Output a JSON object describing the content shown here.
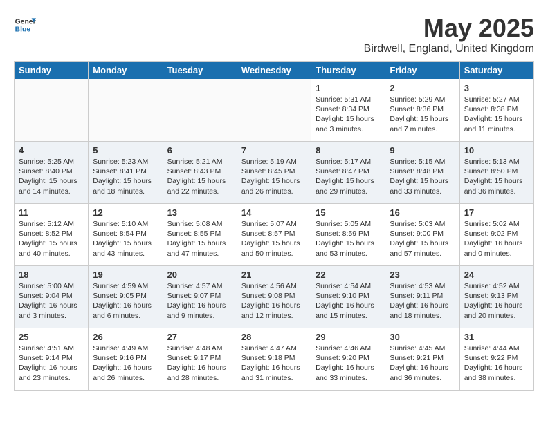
{
  "header": {
    "logo_general": "General",
    "logo_blue": "Blue",
    "month_title": "May 2025",
    "location": "Birdwell, England, United Kingdom"
  },
  "days_of_week": [
    "Sunday",
    "Monday",
    "Tuesday",
    "Wednesday",
    "Thursday",
    "Friday",
    "Saturday"
  ],
  "weeks": [
    [
      {
        "day": "",
        "content": ""
      },
      {
        "day": "",
        "content": ""
      },
      {
        "day": "",
        "content": ""
      },
      {
        "day": "",
        "content": ""
      },
      {
        "day": "1",
        "content": "Sunrise: 5:31 AM\nSunset: 8:34 PM\nDaylight: 15 hours\nand 3 minutes."
      },
      {
        "day": "2",
        "content": "Sunrise: 5:29 AM\nSunset: 8:36 PM\nDaylight: 15 hours\nand 7 minutes."
      },
      {
        "day": "3",
        "content": "Sunrise: 5:27 AM\nSunset: 8:38 PM\nDaylight: 15 hours\nand 11 minutes."
      }
    ],
    [
      {
        "day": "4",
        "content": "Sunrise: 5:25 AM\nSunset: 8:40 PM\nDaylight: 15 hours\nand 14 minutes."
      },
      {
        "day": "5",
        "content": "Sunrise: 5:23 AM\nSunset: 8:41 PM\nDaylight: 15 hours\nand 18 minutes."
      },
      {
        "day": "6",
        "content": "Sunrise: 5:21 AM\nSunset: 8:43 PM\nDaylight: 15 hours\nand 22 minutes."
      },
      {
        "day": "7",
        "content": "Sunrise: 5:19 AM\nSunset: 8:45 PM\nDaylight: 15 hours\nand 26 minutes."
      },
      {
        "day": "8",
        "content": "Sunrise: 5:17 AM\nSunset: 8:47 PM\nDaylight: 15 hours\nand 29 minutes."
      },
      {
        "day": "9",
        "content": "Sunrise: 5:15 AM\nSunset: 8:48 PM\nDaylight: 15 hours\nand 33 minutes."
      },
      {
        "day": "10",
        "content": "Sunrise: 5:13 AM\nSunset: 8:50 PM\nDaylight: 15 hours\nand 36 minutes."
      }
    ],
    [
      {
        "day": "11",
        "content": "Sunrise: 5:12 AM\nSunset: 8:52 PM\nDaylight: 15 hours\nand 40 minutes."
      },
      {
        "day": "12",
        "content": "Sunrise: 5:10 AM\nSunset: 8:54 PM\nDaylight: 15 hours\nand 43 minutes."
      },
      {
        "day": "13",
        "content": "Sunrise: 5:08 AM\nSunset: 8:55 PM\nDaylight: 15 hours\nand 47 minutes."
      },
      {
        "day": "14",
        "content": "Sunrise: 5:07 AM\nSunset: 8:57 PM\nDaylight: 15 hours\nand 50 minutes."
      },
      {
        "day": "15",
        "content": "Sunrise: 5:05 AM\nSunset: 8:59 PM\nDaylight: 15 hours\nand 53 minutes."
      },
      {
        "day": "16",
        "content": "Sunrise: 5:03 AM\nSunset: 9:00 PM\nDaylight: 15 hours\nand 57 minutes."
      },
      {
        "day": "17",
        "content": "Sunrise: 5:02 AM\nSunset: 9:02 PM\nDaylight: 16 hours\nand 0 minutes."
      }
    ],
    [
      {
        "day": "18",
        "content": "Sunrise: 5:00 AM\nSunset: 9:04 PM\nDaylight: 16 hours\nand 3 minutes."
      },
      {
        "day": "19",
        "content": "Sunrise: 4:59 AM\nSunset: 9:05 PM\nDaylight: 16 hours\nand 6 minutes."
      },
      {
        "day": "20",
        "content": "Sunrise: 4:57 AM\nSunset: 9:07 PM\nDaylight: 16 hours\nand 9 minutes."
      },
      {
        "day": "21",
        "content": "Sunrise: 4:56 AM\nSunset: 9:08 PM\nDaylight: 16 hours\nand 12 minutes."
      },
      {
        "day": "22",
        "content": "Sunrise: 4:54 AM\nSunset: 9:10 PM\nDaylight: 16 hours\nand 15 minutes."
      },
      {
        "day": "23",
        "content": "Sunrise: 4:53 AM\nSunset: 9:11 PM\nDaylight: 16 hours\nand 18 minutes."
      },
      {
        "day": "24",
        "content": "Sunrise: 4:52 AM\nSunset: 9:13 PM\nDaylight: 16 hours\nand 20 minutes."
      }
    ],
    [
      {
        "day": "25",
        "content": "Sunrise: 4:51 AM\nSunset: 9:14 PM\nDaylight: 16 hours\nand 23 minutes."
      },
      {
        "day": "26",
        "content": "Sunrise: 4:49 AM\nSunset: 9:16 PM\nDaylight: 16 hours\nand 26 minutes."
      },
      {
        "day": "27",
        "content": "Sunrise: 4:48 AM\nSunset: 9:17 PM\nDaylight: 16 hours\nand 28 minutes."
      },
      {
        "day": "28",
        "content": "Sunrise: 4:47 AM\nSunset: 9:18 PM\nDaylight: 16 hours\nand 31 minutes."
      },
      {
        "day": "29",
        "content": "Sunrise: 4:46 AM\nSunset: 9:20 PM\nDaylight: 16 hours\nand 33 minutes."
      },
      {
        "day": "30",
        "content": "Sunrise: 4:45 AM\nSunset: 9:21 PM\nDaylight: 16 hours\nand 36 minutes."
      },
      {
        "day": "31",
        "content": "Sunrise: 4:44 AM\nSunset: 9:22 PM\nDaylight: 16 hours\nand 38 minutes."
      }
    ]
  ]
}
